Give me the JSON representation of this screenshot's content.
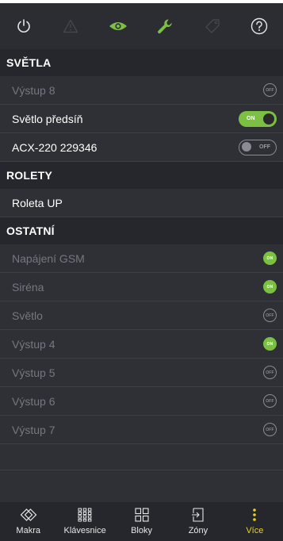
{
  "colors": {
    "accent_green": "#7bc043",
    "active_yellow": "#e8d21c",
    "background": "#2f3036",
    "header_bg": "#26272c",
    "dim_text": "#757780"
  },
  "topbar": {
    "icons": [
      "power-icon",
      "warning-icon",
      "eye-icon",
      "wrench-icon",
      "tag-icon",
      "help-icon"
    ]
  },
  "sections": {
    "svetla": {
      "title": "SVĚTLA",
      "rows": [
        {
          "label": "Výstup  8",
          "state": "off",
          "dim": true
        },
        {
          "label": "Světlo předsíň",
          "state": "ON",
          "dim": false
        },
        {
          "label": "ACX-220  229346",
          "state": "OFF",
          "dim": false
        }
      ]
    },
    "rolety": {
      "title": "ROLETY",
      "rows": [
        {
          "label": "Roleta UP"
        }
      ]
    },
    "ostatni": {
      "title": "OSTATNÍ",
      "rows": [
        {
          "label": "Napájení GSM",
          "state": "on"
        },
        {
          "label": "Siréna",
          "state": "on"
        },
        {
          "label": "Světlo",
          "state": "off"
        },
        {
          "label": "Výstup  4",
          "state": "on"
        },
        {
          "label": "Výstup  5",
          "state": "off"
        },
        {
          "label": "Výstup  6",
          "state": "off"
        },
        {
          "label": "Výstup  7",
          "state": "off"
        }
      ]
    }
  },
  "badges": {
    "on": "ON",
    "off": "OFF"
  },
  "bottomnav": {
    "items": [
      {
        "label": "Makra",
        "icon": "macro-icon"
      },
      {
        "label": "Klávesnice",
        "icon": "keypad-icon"
      },
      {
        "label": "Bloky",
        "icon": "blocks-icon"
      },
      {
        "label": "Zóny",
        "icon": "zones-icon"
      },
      {
        "label": "Více",
        "icon": "more-icon",
        "active": true
      }
    ]
  }
}
